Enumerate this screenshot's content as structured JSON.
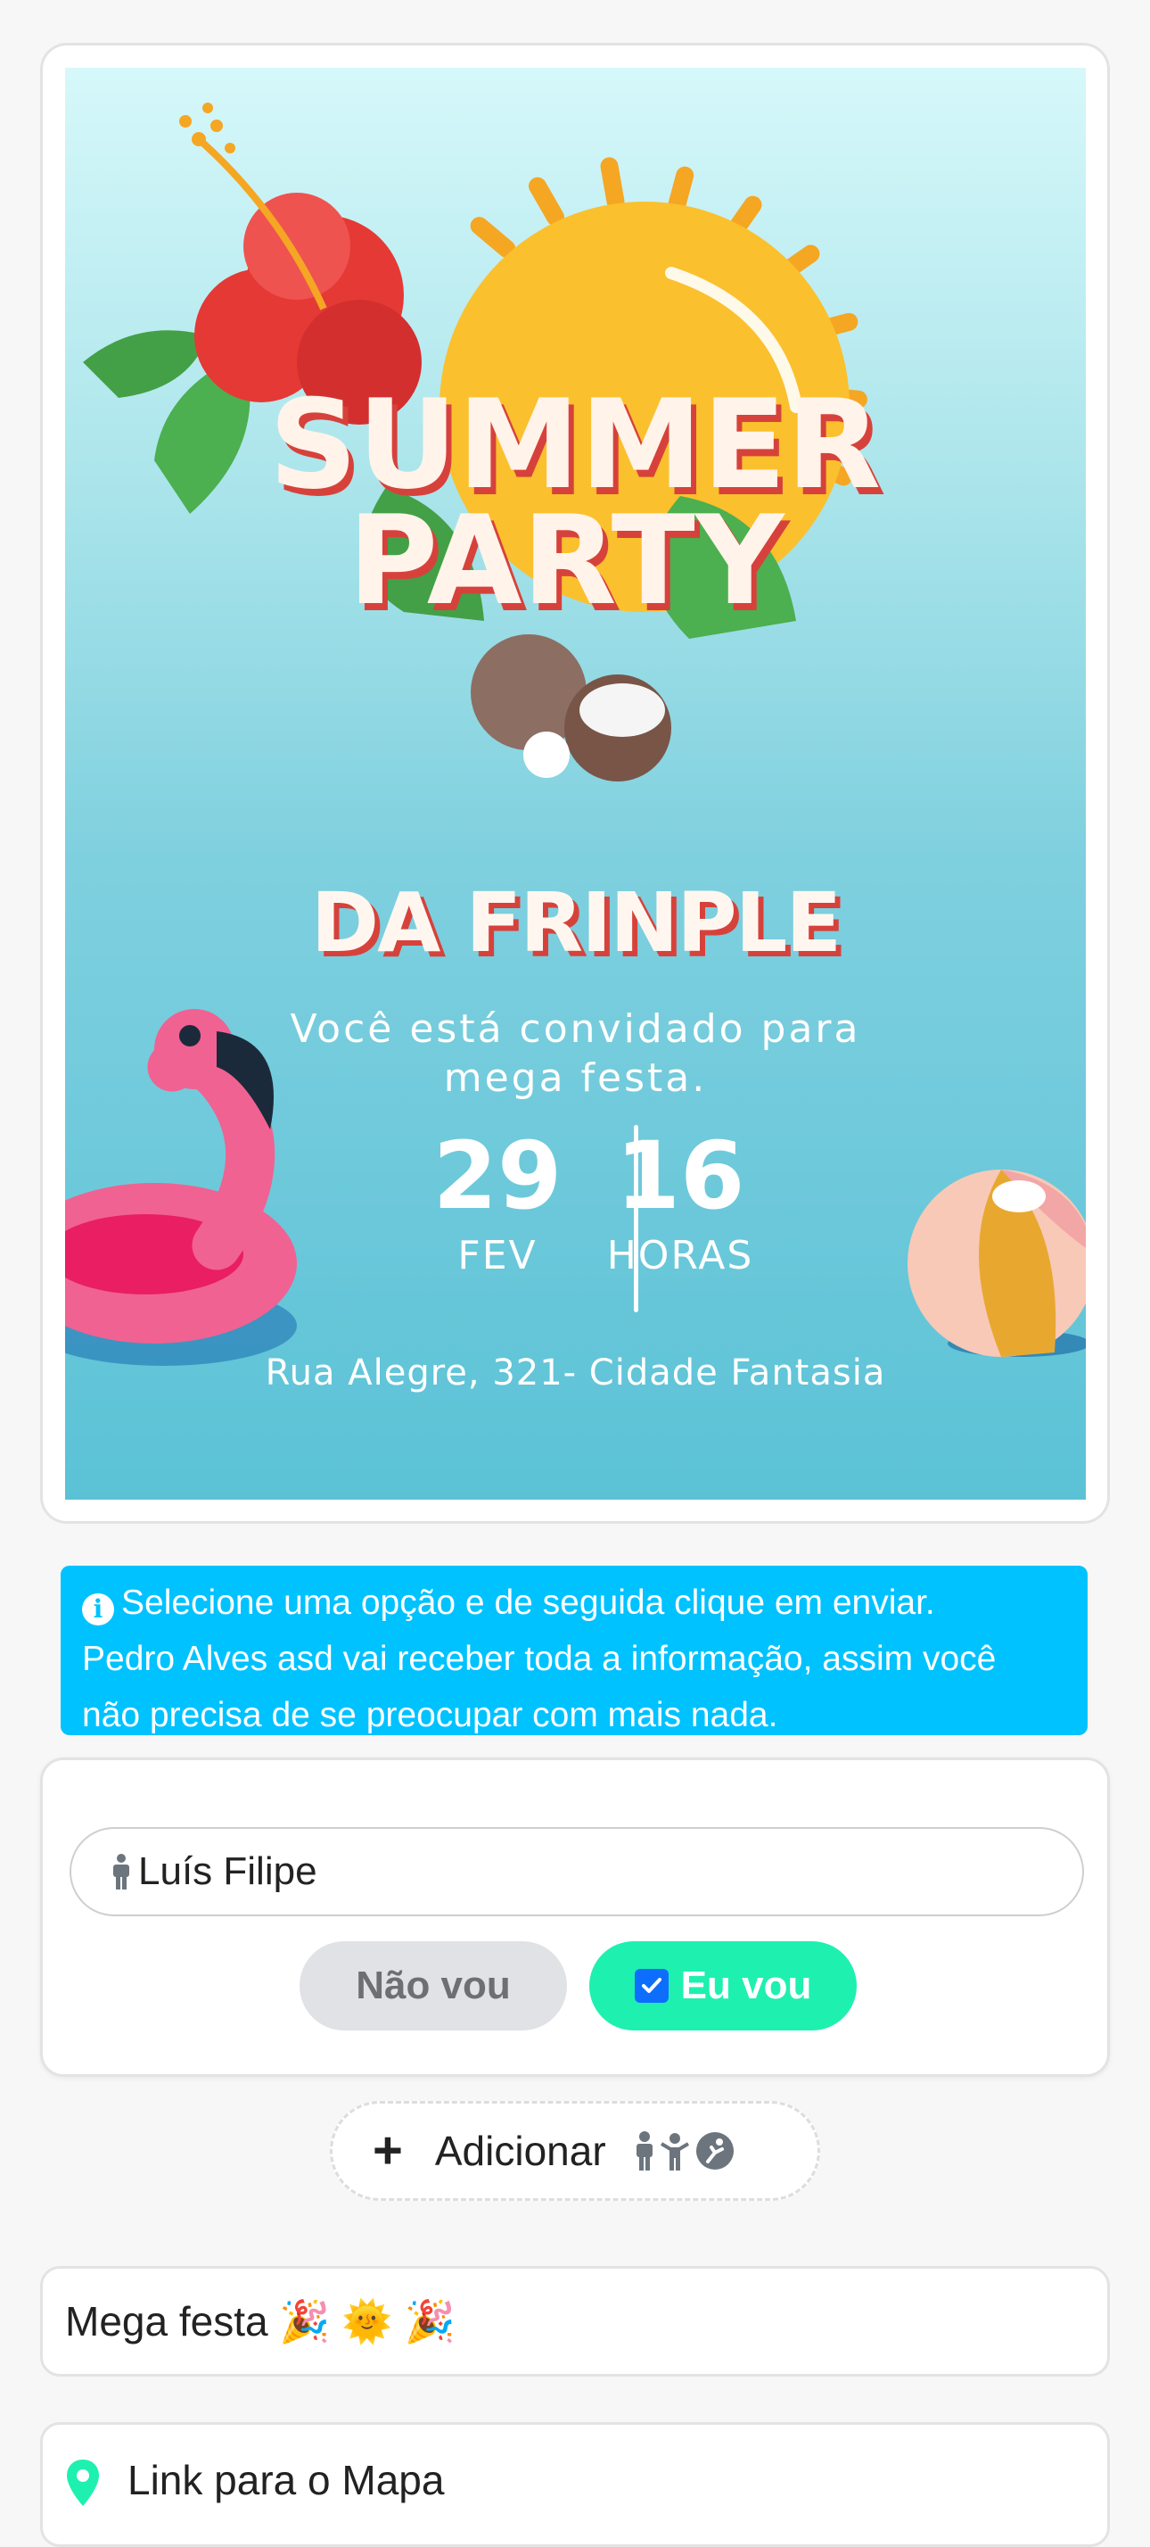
{
  "invite": {
    "title_line1": "SUMMER",
    "title_line2": "PARTY",
    "host": "DA FRINPLE",
    "invite_line1": "Você está convidado para",
    "invite_line2": "mega festa.",
    "day": "29",
    "month": "FEV",
    "hour": "16",
    "hour_label": "HORAS",
    "address": "Rua Alegre, 321- Cidade Fantasia"
  },
  "info": {
    "icon": "info-icon",
    "line1": "Selecione uma opção e de seguida clique em enviar.",
    "line2": "Pedro Alves asd vai receber toda a informação, assim você",
    "line3": "não precisa de se preocupar com mais nada."
  },
  "rsvp": {
    "guest_name": "Luís Filipe",
    "decline_label": "Não vou",
    "accept_label": "Eu vou",
    "accept_checked": true
  },
  "add_guest": {
    "label": "Adicionar",
    "icons": [
      "adult-icon",
      "child-icon",
      "baby-icon"
    ]
  },
  "description": {
    "text": "Mega festa 🎉 🌞 🎉"
  },
  "map": {
    "label": "Link para o Mapa"
  },
  "colors": {
    "info_bg": "#00c2ff",
    "accept_bg": "#1ef0b0",
    "decline_bg": "#e1e2e5",
    "checkbox": "#0d6efd",
    "map_pin": "#1ef0b0"
  }
}
